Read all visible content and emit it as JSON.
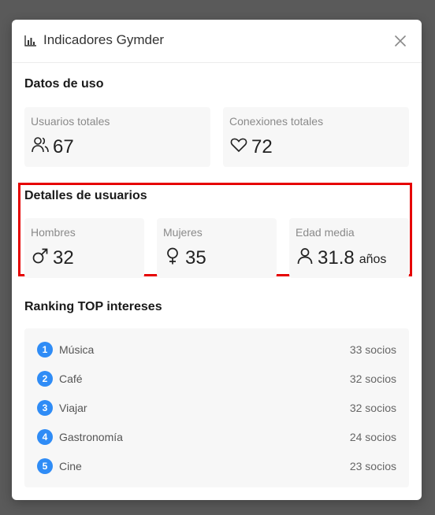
{
  "modal": {
    "title": "Indicadores Gymder",
    "header_icon": "bar-chart-icon",
    "close_icon": "close-icon"
  },
  "usage": {
    "title": "Datos de uso",
    "total_users": {
      "label": "Usuarios totales",
      "value": "67",
      "icon": "users-icon"
    },
    "total_connections": {
      "label": "Conexiones totales",
      "value": "72",
      "icon": "heart-icon"
    }
  },
  "user_details": {
    "title": "Detalles de usuarios",
    "men": {
      "label": "Hombres",
      "value": "32",
      "icon": "male-icon"
    },
    "women": {
      "label": "Mujeres",
      "value": "35",
      "icon": "female-icon"
    },
    "avg_age": {
      "label": "Edad media",
      "value": "31.8",
      "unit": "años",
      "icon": "user-icon"
    }
  },
  "ranking": {
    "title": "Ranking TOP intereses",
    "items": [
      {
        "rank": "1",
        "name": "Música",
        "count": "33 socios"
      },
      {
        "rank": "2",
        "name": "Café",
        "count": "32 socios"
      },
      {
        "rank": "3",
        "name": "Viajar",
        "count": "32 socios"
      },
      {
        "rank": "4",
        "name": "Gastronomía",
        "count": "24 socios"
      },
      {
        "rank": "5",
        "name": "Cine",
        "count": "23 socios"
      }
    ]
  },
  "colors": {
    "accent": "#2f8cf6",
    "highlight_border": "#e60000",
    "card_bg": "#f7f7f7",
    "backdrop": "#5a5a5a"
  }
}
